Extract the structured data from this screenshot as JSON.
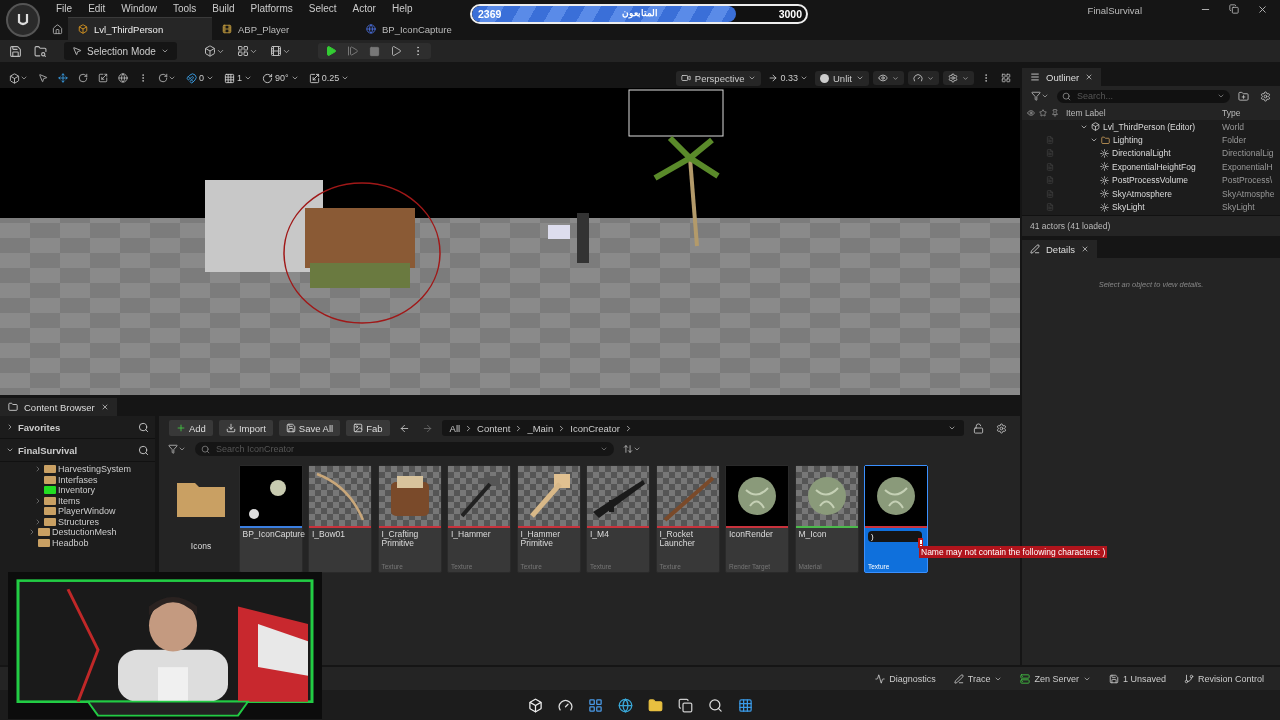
{
  "title_bar": {
    "menu": [
      "File",
      "Edit",
      "Window",
      "Tools",
      "Build",
      "Platforms",
      "Select",
      "Actor",
      "Help"
    ],
    "tabs": [
      {
        "label": "Lvl_ThirdPerson",
        "selected": true
      },
      {
        "label": "ABP_Player",
        "selected": false
      },
      {
        "label": "BP_IconCapture",
        "selected": false
      }
    ],
    "project": "FinalSurvival"
  },
  "followers": {
    "current": "2369",
    "label": "المتابعون",
    "goal": "3000",
    "level": 0.79
  },
  "toolbar": {
    "mode": "Selection Mode"
  },
  "viewport": {
    "snaps": [
      "0",
      "1",
      "90°",
      "0.25"
    ],
    "view": "Perspective",
    "speed": "0.33",
    "lighting": "Unlit"
  },
  "outliner": {
    "title": "Outliner",
    "search_placeholder": "Search...",
    "columns": [
      "Item Label",
      "Type"
    ],
    "rows": [
      {
        "label": "Lvl_ThirdPerson (Editor)",
        "type": "World",
        "expanded": true,
        "children": [
          {
            "label": "Lighting",
            "type": "Folder",
            "expanded": true,
            "children": [
              {
                "label": "DirectionalLight",
                "type": "DirectionalLig"
              },
              {
                "label": "ExponentialHeightFog",
                "type": "ExponentialH"
              },
              {
                "label": "PostProcessVolume",
                "type": "PostProcess\\"
              },
              {
                "label": "SkyAtmosphere",
                "type": "SkyAtmosphe"
              },
              {
                "label": "SkyLight",
                "type": "SkyLight"
              }
            ]
          }
        ]
      }
    ],
    "status": "41 actors (41 loaded)"
  },
  "details": {
    "title": "Details",
    "hint": "Select an object to view details."
  },
  "content_browser": {
    "title": "Content Browser",
    "sections": [
      "Favorites",
      "FinalSurvival"
    ],
    "folders": [
      {
        "children": [
          {
            "name": "HarvestingSystem",
            "kind": "collapsed",
            "color": "#c9a063"
          },
          {
            "name": "Interfases",
            "kind": "leaf",
            "color": "#c9a063"
          },
          {
            "name": "Inventory",
            "kind": "leaf",
            "color": "#22dd22"
          },
          {
            "name": "Items",
            "kind": "collapsed",
            "color": "#c9a063"
          },
          {
            "name": "PlayerWindow",
            "kind": "leaf",
            "color": "#c9a063"
          },
          {
            "name": "Structures",
            "kind": "collapsed",
            "color": "#c9a063"
          }
        ]
      },
      {
        "name": "DestuctionMesh",
        "kind": "collapsed",
        "color": "#c9a063"
      },
      {
        "name": "Headbob",
        "kind": "leaf",
        "color": "#c9a063"
      }
    ],
    "buttons": [
      "Add",
      "Import",
      "Save All",
      "Fab"
    ],
    "path": [
      "All",
      "Content",
      "_Main",
      "IconCreator"
    ],
    "search_placeholder": "Search IconCreator",
    "assets": [
      {
        "kind": "folder",
        "name": "Icons",
        "selected": false
      },
      {
        "kind": "asset",
        "name": "BP_IconCapture",
        "color": "#3b7fe0",
        "selected": false
      },
      {
        "kind": "asset",
        "name": "I_Bow01",
        "color": "#c8323c",
        "selected": false
      },
      {
        "kind": "asset",
        "name": "I_Crafting Primitive",
        "type": "Texture",
        "color": "#c8323c",
        "selected": false
      },
      {
        "kind": "asset",
        "name": "I_Hammer",
        "type": "Texture",
        "color": "#c8323c",
        "selected": false
      },
      {
        "kind": "asset",
        "name": "I_Hammer Primitive",
        "type": "Texture",
        "color": "#c8323c",
        "selected": false
      },
      {
        "kind": "asset",
        "name": "I_M4",
        "type": "Texture",
        "color": "#c8323c",
        "selected": false
      },
      {
        "kind": "asset",
        "name": "I_Rocket Launcher",
        "type": "Texture",
        "color": "#c8323c",
        "selected": false
      },
      {
        "kind": "asset",
        "name": "IconRender",
        "type": "Render Target",
        "color": "#c8323c",
        "selected": false
      },
      {
        "kind": "asset",
        "name": "M_Icon",
        "type": "Material",
        "color": "#4cbb4c",
        "selected": false
      },
      {
        "kind": "rename",
        "value": ")",
        "error": "Name may not contain the following characters: )",
        "type": "Texture",
        "color": "#c8323c",
        "selected": true
      }
    ]
  },
  "status_bar": {
    "items": [
      "Diagnostics",
      "Trace",
      "Zen Server",
      "1 Unsaved",
      "Revision Control"
    ]
  }
}
